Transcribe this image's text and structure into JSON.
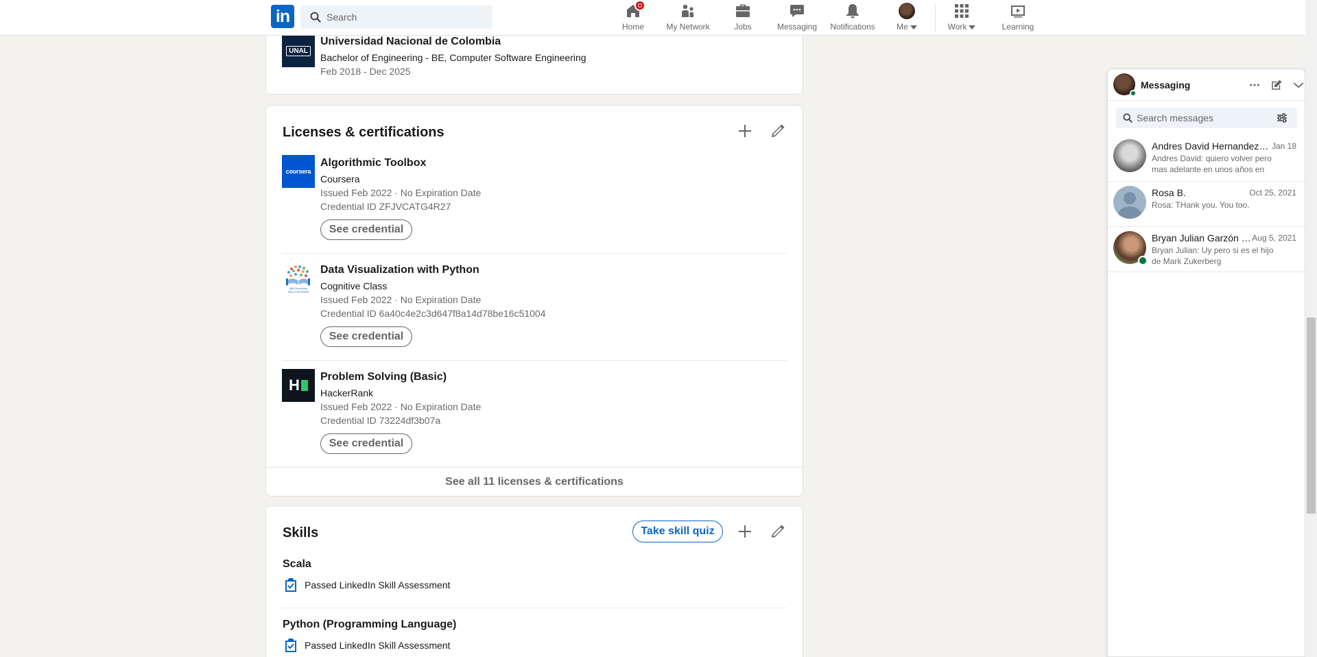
{
  "nav": {
    "search_placeholder": "Search",
    "items": [
      {
        "label": "Home",
        "icon": "home-icon"
      },
      {
        "label": "My Network",
        "icon": "network-icon"
      },
      {
        "label": "Jobs",
        "icon": "briefcase-icon"
      },
      {
        "label": "Messaging",
        "icon": "chat-icon"
      },
      {
        "label": "Notifications",
        "icon": "bell-icon"
      },
      {
        "label": "Me",
        "icon": "avatar"
      },
      {
        "label": "Work",
        "icon": "grid-icon"
      },
      {
        "label": "Learning",
        "icon": "play-icon"
      }
    ],
    "logo_text": "in"
  },
  "education": {
    "logo_text": "UNAL",
    "school": "Universidad Nacional de Colombia",
    "degree": "Bachelor of Engineering - BE, Computer Software Engineering",
    "dates": "Feb 2018 - Dec 2025"
  },
  "licenses": {
    "title": "Licenses & certifications",
    "items": [
      {
        "name": "Algorithmic Toolbox",
        "issuer": "Coursera",
        "issued": "Issued Feb 2022 · No Expiration Date",
        "credential": "Credential ID ZFJVCATG4R27",
        "button": "See credential",
        "logo_text": "coursera"
      },
      {
        "name": "Data Visualization with Python",
        "issuer": "Cognitive Class",
        "issued": "Issued Feb 2022 · No Expiration Date",
        "credential": "Credential ID 6a40c4e2c3d647f8a14d78be16c51004",
        "button": "See credential",
        "logo_text": "IBM Developer SKILLS NETWORK"
      },
      {
        "name": "Problem Solving (Basic)",
        "issuer": "HackerRank",
        "issued": "Issued Feb 2022 · No Expiration Date",
        "credential": "Credential ID 73224df3b07a",
        "button": "See credential",
        "logo_text": "H"
      }
    ],
    "see_all": "See all 11 licenses & certifications"
  },
  "skills": {
    "title": "Skills",
    "quiz_button": "Take skill quiz",
    "items": [
      {
        "name": "Scala",
        "assessment": "Passed LinkedIn Skill Assessment"
      },
      {
        "name": "Python (Programming Language)",
        "assessment": "Passed LinkedIn Skill Assessment"
      }
    ]
  },
  "messaging": {
    "title": "Messaging",
    "search_placeholder": "Search messages",
    "conversations": [
      {
        "name": "Andres David Hernandez S...",
        "date": "Jan 18",
        "snippet": "Andres David: quiero volver pero mas adelante en unos años en ot..."
      },
      {
        "name": "Rosa B.",
        "date": "Oct 25, 2021",
        "snippet": "Rosa: THank you. You too."
      },
      {
        "name": "Bryan Julian Garzón Ri...",
        "date": "Aug 5, 2021",
        "snippet": "Bryan Julian: Uy pero si es el hijo de Mark Zukerberg"
      }
    ]
  },
  "colors": {
    "brand": "#0a66c2",
    "notification_badge": "#cc1016",
    "online": "#057642"
  }
}
